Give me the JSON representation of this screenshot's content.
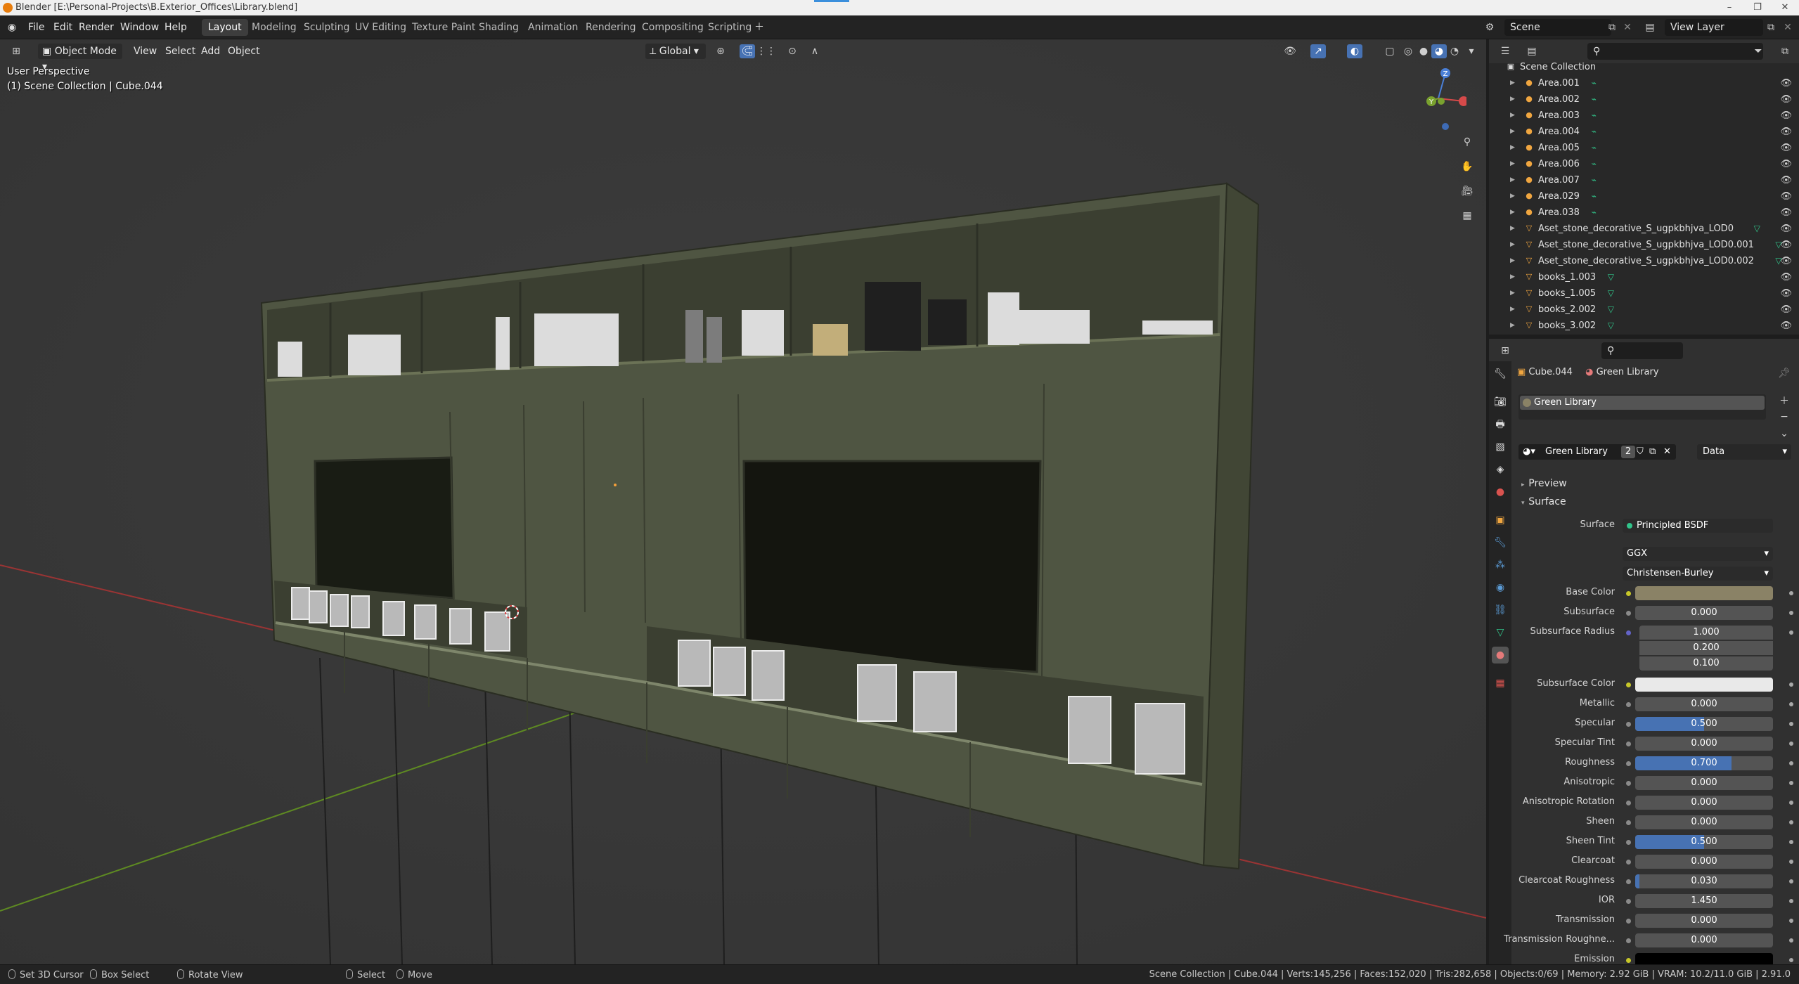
{
  "window": {
    "title": "Blender [E:\\Personal-Projects\\B.Exterior_Offices\\Library.blend]",
    "minimize": "–",
    "restore": "❐",
    "close": "✕"
  },
  "menu": [
    "File",
    "Edit",
    "Render",
    "Window",
    "Help"
  ],
  "workspaces": [
    "Layout",
    "Modeling",
    "Sculpting",
    "UV Editing",
    "Texture Paint",
    "Shading",
    "Animation",
    "Rendering",
    "Compositing",
    "Scripting"
  ],
  "workspace_active": "Layout",
  "scene": {
    "name": "Scene",
    "view_layer": "View Layer"
  },
  "viewport": {
    "mode": "Object Mode",
    "menus": [
      "View",
      "Select",
      "Add",
      "Object"
    ],
    "transform_orientation": "Global",
    "perspective": "User Perspective",
    "context": "(1) Scene Collection | Cube.044",
    "gizmo": {
      "z": "Z",
      "y": "Y",
      "x": "X"
    }
  },
  "outliner": {
    "root": "Scene Collection",
    "items": [
      {
        "name": "Area.001",
        "type": "light"
      },
      {
        "name": "Area.002",
        "type": "light"
      },
      {
        "name": "Area.003",
        "type": "light"
      },
      {
        "name": "Area.004",
        "type": "light"
      },
      {
        "name": "Area.005",
        "type": "light"
      },
      {
        "name": "Area.006",
        "type": "light"
      },
      {
        "name": "Area.007",
        "type": "light"
      },
      {
        "name": "Area.029",
        "type": "light"
      },
      {
        "name": "Area.038",
        "type": "light"
      },
      {
        "name": "Aset_stone_decorative_S_ugpkbhjva_LOD0",
        "type": "mesh"
      },
      {
        "name": "Aset_stone_decorative_S_ugpkbhjva_LOD0.001",
        "type": "mesh"
      },
      {
        "name": "Aset_stone_decorative_S_ugpkbhjva_LOD0.002",
        "type": "mesh"
      },
      {
        "name": "books_1.003",
        "type": "mesh"
      },
      {
        "name": "books_1.005",
        "type": "mesh"
      },
      {
        "name": "books_2.002",
        "type": "mesh"
      },
      {
        "name": "books_3.002",
        "type": "mesh"
      }
    ]
  },
  "properties": {
    "object": "Cube.044",
    "material": "Green Library",
    "slot": "Green Library",
    "material_users": "2",
    "link": "Data",
    "sections": {
      "preview": "Preview",
      "surface": "Surface"
    },
    "surface_label": "Surface",
    "surface_shader": "Principled BSDF",
    "distribution": "GGX",
    "subsurface_method": "Christensen-Burley",
    "base_color_label": "Base Color",
    "base_color": "#8a8266",
    "subsurface_color_label": "Subsurface Color",
    "subsurface_color": "#e9e9e9",
    "subsurface_radius_label": "Subsurface Radius",
    "subsurface_radius": [
      "1.000",
      "0.200",
      "0.100"
    ],
    "emission_label": "Emission",
    "emission_color": "#000000",
    "fields": [
      {
        "label": "Subsurface",
        "value": "0.000",
        "fill": 0
      },
      {
        "label": "Metallic",
        "value": "0.000",
        "fill": 0
      },
      {
        "label": "Specular",
        "value": "0.500",
        "fill": 0.5
      },
      {
        "label": "Specular Tint",
        "value": "0.000",
        "fill": 0
      },
      {
        "label": "Roughness",
        "value": "0.700",
        "fill": 0.7
      },
      {
        "label": "Anisotropic",
        "value": "0.000",
        "fill": 0
      },
      {
        "label": "Anisotropic Rotation",
        "value": "0.000",
        "fill": 0
      },
      {
        "label": "Sheen",
        "value": "0.000",
        "fill": 0
      },
      {
        "label": "Sheen Tint",
        "value": "0.500",
        "fill": 0.5
      },
      {
        "label": "Clearcoat",
        "value": "0.000",
        "fill": 0
      },
      {
        "label": "Clearcoat Roughness",
        "value": "0.030",
        "fill": 0.03
      },
      {
        "label": "IOR",
        "value": "1.450",
        "fill": 0
      },
      {
        "label": "Transmission",
        "value": "0.000",
        "fill": 0
      },
      {
        "label": "Transmission Roughne...",
        "value": "0.000",
        "fill": 0
      }
    ]
  },
  "statusbar": {
    "set_cursor": "Set 3D Cursor",
    "box_select": "Box Select",
    "rotate_view": "Rotate View",
    "select": "Select",
    "move": "Move",
    "stats": "Scene Collection | Cube.044 | Verts:145,256 | Faces:152,020 | Tris:282,658 | Objects:0/69 | Memory: 2.92 GiB | VRAM: 10.2/11.0 GiB | 2.91.0"
  },
  "colors": {
    "accent": "#4772b3",
    "viewport_bg": "#393939",
    "shelf": "#4f5542",
    "axis_x": "#c23b3b",
    "axis_y": "#6c9a2a"
  }
}
